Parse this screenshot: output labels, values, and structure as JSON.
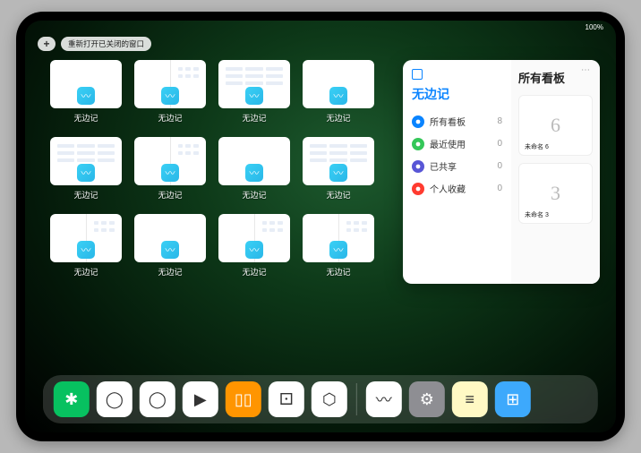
{
  "status": {
    "time": "",
    "battery": "100%"
  },
  "topbar": {
    "plus_label": "+",
    "reopen_label": "重新打开已关闭的窗口"
  },
  "app_windows": [
    {
      "label": "无边记",
      "type": "blank"
    },
    {
      "label": "无边记",
      "type": "split"
    },
    {
      "label": "无边记",
      "type": "grid"
    },
    {
      "label": "无边记",
      "type": "blank"
    },
    {
      "label": "无边记",
      "type": "grid"
    },
    {
      "label": "无边记",
      "type": "split"
    },
    {
      "label": "无边记",
      "type": "blank"
    },
    {
      "label": "无边记",
      "type": "grid"
    },
    {
      "label": "无边记",
      "type": "split"
    },
    {
      "label": "无边记",
      "type": "blank"
    },
    {
      "label": "无边记",
      "type": "split"
    },
    {
      "label": "无边记",
      "type": "split"
    }
  ],
  "panel": {
    "left_title": "无边记",
    "right_title": "所有看板",
    "items": [
      {
        "label": "所有看板",
        "count": 8,
        "icon": "grid",
        "color": "blue"
      },
      {
        "label": "最近使用",
        "count": 0,
        "icon": "clock",
        "color": "green"
      },
      {
        "label": "已共享",
        "count": 0,
        "icon": "people",
        "color": "indigo"
      },
      {
        "label": "个人收藏",
        "count": 0,
        "icon": "heart",
        "color": "red"
      }
    ],
    "boards": [
      {
        "label": "未命名 6",
        "glyph": "6"
      },
      {
        "label": "未命名 3",
        "glyph": "3"
      }
    ]
  },
  "dock": [
    {
      "name": "wechat",
      "bg": "#07c160",
      "glyph": "✱"
    },
    {
      "name": "quark-hd",
      "bg": "#ffffff",
      "glyph": "◯"
    },
    {
      "name": "qq-browser",
      "bg": "#ffffff",
      "glyph": "◯"
    },
    {
      "name": "media",
      "bg": "#ffffff",
      "glyph": "▶"
    },
    {
      "name": "books",
      "bg": "#ff9500",
      "glyph": "▯▯"
    },
    {
      "name": "dice",
      "bg": "#ffffff",
      "glyph": "⚀"
    },
    {
      "name": "shapes",
      "bg": "#ffffff",
      "glyph": "⬡"
    },
    {
      "name": "freeform",
      "bg": "#ffffff",
      "glyph": "〰"
    },
    {
      "name": "settings",
      "bg": "#8e8e93",
      "glyph": "⚙"
    },
    {
      "name": "notes",
      "bg": "#fff9c4",
      "glyph": "≡"
    },
    {
      "name": "app-library",
      "bg": "#3da9fc",
      "glyph": "⊞"
    }
  ]
}
